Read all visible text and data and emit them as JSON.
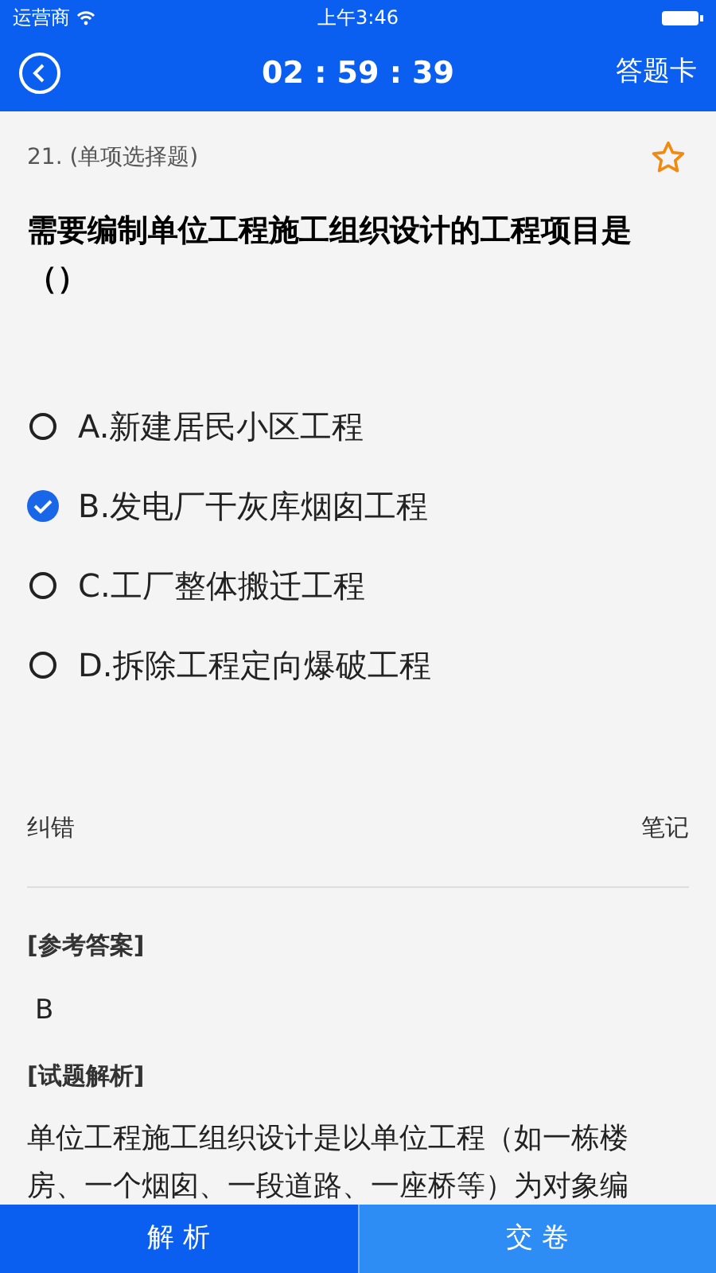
{
  "status_bar": {
    "carrier": "运营商",
    "time": "上午3:46"
  },
  "nav": {
    "timer": "02 : 59 : 39",
    "answer_card": "答题卡"
  },
  "question": {
    "number": "21. (单项选择题)",
    "favorited": false,
    "text": "需要编制单位工程施工组织设计的工程项目是（）"
  },
  "options": [
    {
      "label": "A.新建居民小区工程",
      "selected": false
    },
    {
      "label": "B.发电厂干灰库烟囱工程",
      "selected": true
    },
    {
      "label": "C.工厂整体搬迁工程",
      "selected": false
    },
    {
      "label": "D.拆除工程定向爆破工程",
      "selected": false
    }
  ],
  "actions": {
    "report_error": "纠错",
    "notes": "笔记"
  },
  "answer": {
    "heading": "[参考答案]",
    "value": "B"
  },
  "analysis": {
    "heading": "[试题解析]",
    "text": "单位工程施工组织设计是以单位工程（如一栋楼房、一个烟囱、一段道路、一座桥等）为对象编"
  },
  "bottom_bar": [
    {
      "label": "解 析",
      "selected": true
    },
    {
      "label": "交 卷",
      "selected": false
    }
  ]
}
